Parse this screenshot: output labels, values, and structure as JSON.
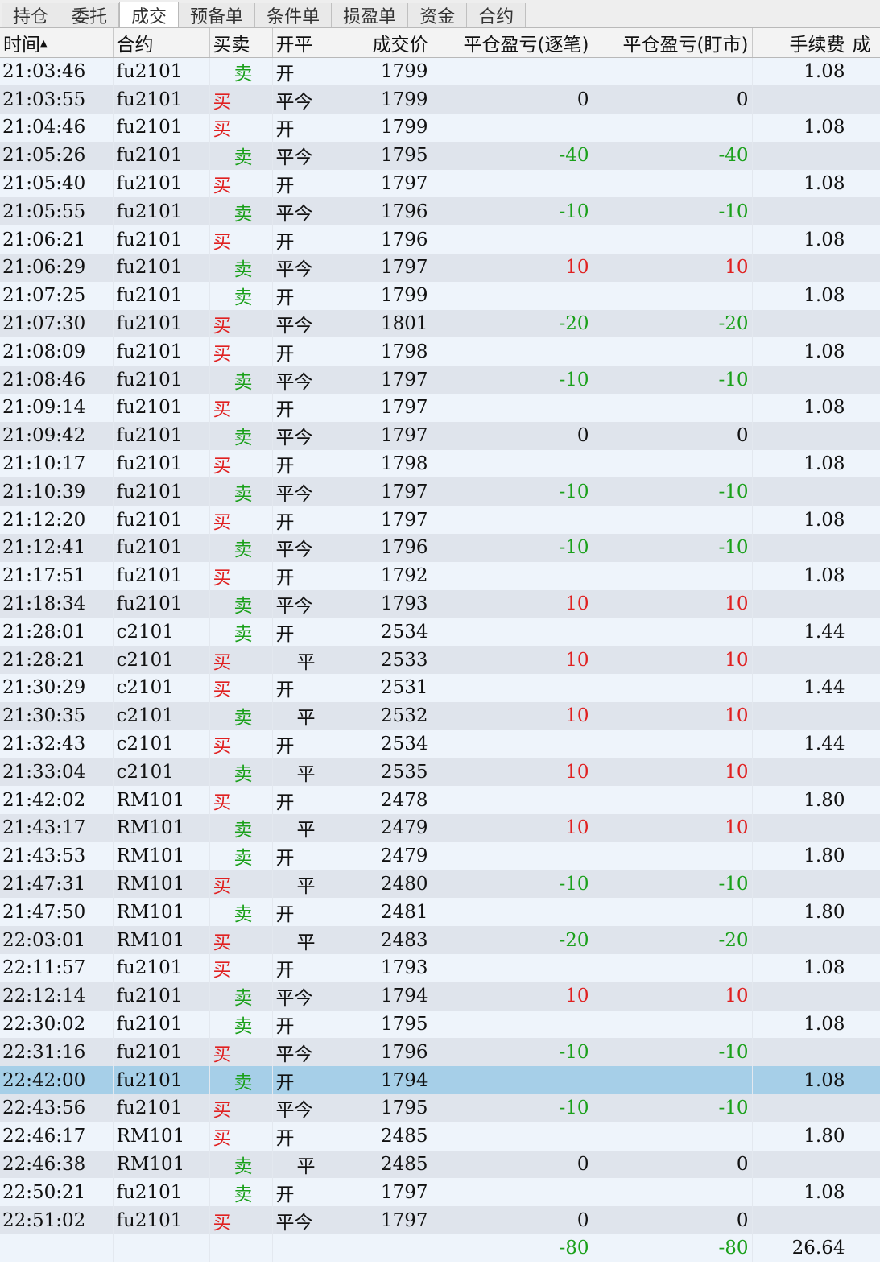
{
  "tabs": [
    "持仓",
    "委托",
    "成交",
    "预备单",
    "条件单",
    "损盈单",
    "资金",
    "合约"
  ],
  "active_tab": 2,
  "columns": [
    "时间",
    "合约",
    "买卖",
    "开平",
    "成交价",
    "平仓盈亏(逐笔)",
    "平仓盈亏(盯市)",
    "手续费",
    "成"
  ],
  "sort_indicator": "▲",
  "selected_row": 36,
  "rows": [
    [
      "21:03:46",
      "fu2101",
      "卖",
      "开",
      "1799",
      "",
      "",
      "1.08"
    ],
    [
      "21:03:55",
      "fu2101",
      "买",
      "平今",
      "1799",
      "0",
      "0",
      ""
    ],
    [
      "21:04:46",
      "fu2101",
      "买",
      "开",
      "1799",
      "",
      "",
      "1.08"
    ],
    [
      "21:05:26",
      "fu2101",
      "卖",
      "平今",
      "1795",
      "-40",
      "-40",
      ""
    ],
    [
      "21:05:40",
      "fu2101",
      "买",
      "开",
      "1797",
      "",
      "",
      "1.08"
    ],
    [
      "21:05:55",
      "fu2101",
      "卖",
      "平今",
      "1796",
      "-10",
      "-10",
      ""
    ],
    [
      "21:06:21",
      "fu2101",
      "买",
      "开",
      "1796",
      "",
      "",
      "1.08"
    ],
    [
      "21:06:29",
      "fu2101",
      "卖",
      "平今",
      "1797",
      "10",
      "10",
      ""
    ],
    [
      "21:07:25",
      "fu2101",
      "卖",
      "开",
      "1799",
      "",
      "",
      "1.08"
    ],
    [
      "21:07:30",
      "fu2101",
      "买",
      "平今",
      "1801",
      "-20",
      "-20",
      ""
    ],
    [
      "21:08:09",
      "fu2101",
      "买",
      "开",
      "1798",
      "",
      "",
      "1.08"
    ],
    [
      "21:08:46",
      "fu2101",
      "卖",
      "平今",
      "1797",
      "-10",
      "-10",
      ""
    ],
    [
      "21:09:14",
      "fu2101",
      "买",
      "开",
      "1797",
      "",
      "",
      "1.08"
    ],
    [
      "21:09:42",
      "fu2101",
      "卖",
      "平今",
      "1797",
      "0",
      "0",
      ""
    ],
    [
      "21:10:17",
      "fu2101",
      "买",
      "开",
      "1798",
      "",
      "",
      "1.08"
    ],
    [
      "21:10:39",
      "fu2101",
      "卖",
      "平今",
      "1797",
      "-10",
      "-10",
      ""
    ],
    [
      "21:12:20",
      "fu2101",
      "买",
      "开",
      "1797",
      "",
      "",
      "1.08"
    ],
    [
      "21:12:41",
      "fu2101",
      "卖",
      "平今",
      "1796",
      "-10",
      "-10",
      ""
    ],
    [
      "21:17:51",
      "fu2101",
      "买",
      "开",
      "1792",
      "",
      "",
      "1.08"
    ],
    [
      "21:18:34",
      "fu2101",
      "卖",
      "平今",
      "1793",
      "10",
      "10",
      ""
    ],
    [
      "21:28:01",
      "c2101",
      "卖",
      "开",
      "2534",
      "",
      "",
      "1.44"
    ],
    [
      "21:28:21",
      "c2101",
      "买",
      "平",
      "2533",
      "10",
      "10",
      ""
    ],
    [
      "21:30:29",
      "c2101",
      "买",
      "开",
      "2531",
      "",
      "",
      "1.44"
    ],
    [
      "21:30:35",
      "c2101",
      "卖",
      "平",
      "2532",
      "10",
      "10",
      ""
    ],
    [
      "21:32:43",
      "c2101",
      "买",
      "开",
      "2534",
      "",
      "",
      "1.44"
    ],
    [
      "21:33:04",
      "c2101",
      "卖",
      "平",
      "2535",
      "10",
      "10",
      ""
    ],
    [
      "21:42:02",
      "RM101",
      "买",
      "开",
      "2478",
      "",
      "",
      "1.80"
    ],
    [
      "21:43:17",
      "RM101",
      "卖",
      "平",
      "2479",
      "10",
      "10",
      ""
    ],
    [
      "21:43:53",
      "RM101",
      "卖",
      "开",
      "2479",
      "",
      "",
      "1.80"
    ],
    [
      "21:47:31",
      "RM101",
      "买",
      "平",
      "2480",
      "-10",
      "-10",
      ""
    ],
    [
      "21:47:50",
      "RM101",
      "卖",
      "开",
      "2481",
      "",
      "",
      "1.80"
    ],
    [
      "22:03:01",
      "RM101",
      "买",
      "平",
      "2483",
      "-20",
      "-20",
      ""
    ],
    [
      "22:11:57",
      "fu2101",
      "买",
      "开",
      "1793",
      "",
      "",
      "1.08"
    ],
    [
      "22:12:14",
      "fu2101",
      "卖",
      "平今",
      "1794",
      "10",
      "10",
      ""
    ],
    [
      "22:30:02",
      "fu2101",
      "卖",
      "开",
      "1795",
      "",
      "",
      "1.08"
    ],
    [
      "22:31:16",
      "fu2101",
      "买",
      "平今",
      "1796",
      "-10",
      "-10",
      ""
    ],
    [
      "22:42:00",
      "fu2101",
      "卖",
      "开",
      "1794",
      "",
      "",
      "1.08"
    ],
    [
      "22:43:56",
      "fu2101",
      "买",
      "平今",
      "1795",
      "-10",
      "-10",
      ""
    ],
    [
      "22:46:17",
      "RM101",
      "买",
      "开",
      "2485",
      "",
      "",
      "1.80"
    ],
    [
      "22:46:38",
      "RM101",
      "卖",
      "平",
      "2485",
      "0",
      "0",
      ""
    ],
    [
      "22:50:21",
      "fu2101",
      "卖",
      "开",
      "1797",
      "",
      "",
      "1.08"
    ],
    [
      "22:51:02",
      "fu2101",
      "买",
      "平今",
      "1797",
      "0",
      "0",
      ""
    ]
  ],
  "totals": {
    "pnl_by_trade": "-80",
    "pnl_mark_to_market": "-80",
    "commission": "26.64"
  },
  "colors": {
    "buy": "#e02020",
    "sell": "#1aa01a",
    "selected_row": "#a6cfe8",
    "row_odd": "#eef4fb",
    "row_even": "#dfe4ec"
  }
}
